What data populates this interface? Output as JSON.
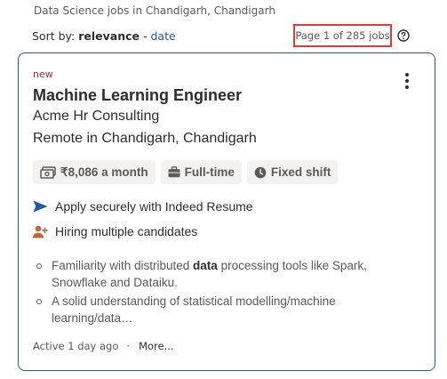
{
  "header": {
    "subtitle": "Data Science jobs in Chandigarh, Chandigarh",
    "sort_prefix": "Sort by: ",
    "sort_active": "relevance",
    "sort_separator": " - ",
    "sort_alt": "date",
    "page_count": "Page 1 of 285 jobs",
    "help_icon": "question-circle-icon"
  },
  "job": {
    "new_label": "new",
    "title": "Machine Learning Engineer",
    "company": "Acme Hr Consulting",
    "location": "Remote in Chandigarh, Chandigarh",
    "menu_icon": "vertical-dots-icon",
    "tags": [
      {
        "icon": "money-icon",
        "label": "₹8,086 a month"
      },
      {
        "icon": "briefcase-icon",
        "label": "Full-time"
      },
      {
        "icon": "clock-icon",
        "label": "Fixed shift"
      }
    ],
    "features": [
      {
        "icon": "send-arrow-icon",
        "label": "Apply securely with Indeed Resume"
      },
      {
        "icon": "person-add-icon",
        "label": "Hiring multiple candidates"
      }
    ],
    "snippet_1": {
      "before": "Familiarity with distributed ",
      "bold": "data",
      "after": " processing tools like Spark, Snowflake and Dataiku."
    },
    "snippet_2": "A solid understanding of statistical modelling/machine learning/data…",
    "active": "Active 1 day ago",
    "separator": "·",
    "more": "More..."
  },
  "colors": {
    "accent_blue": "#2557a7",
    "new_red": "#a9252b",
    "highlight_border": "#e53935",
    "tag_bg": "#f3f2f1",
    "person_icon": "#c1643c"
  }
}
